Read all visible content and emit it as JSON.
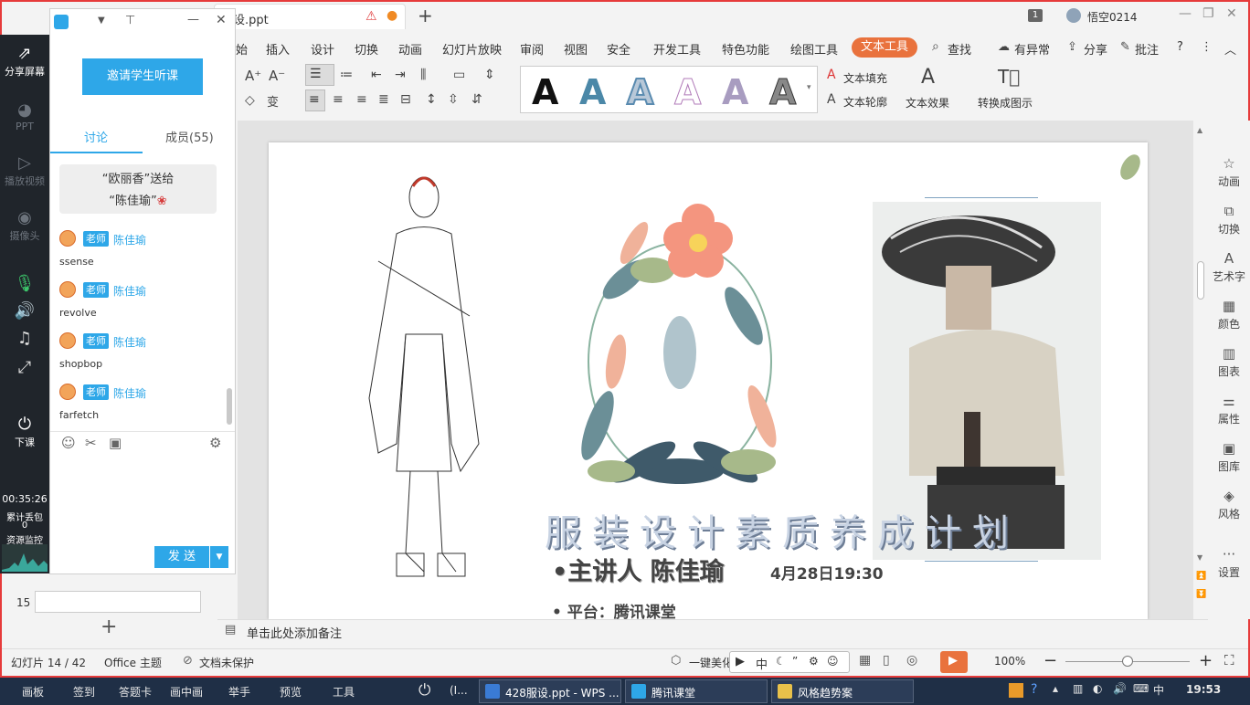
{
  "titlebar": {
    "file_tab": "设.ppt",
    "window_count": "1",
    "user": "悟空0214"
  },
  "ribbon_tabs": [
    "始",
    "插入",
    "设计",
    "切换",
    "动画",
    "幻灯片放映",
    "审阅",
    "视图",
    "安全",
    "开发工具",
    "特色功能",
    "绘图工具",
    "文本工具"
  ],
  "ribbon_right": {
    "search": "查找",
    "issue": "有异常",
    "share": "分享",
    "comment": "批注"
  },
  "ribbon": {
    "text_fill": "文本填充",
    "text_outline": "文本轮廓",
    "text_effect": "文本效果",
    "convert_to_smartart": "转换成图示"
  },
  "slide": {
    "title": "服装设计素质养成计划",
    "speaker": "•主讲人 陈佳瑜",
    "date": "4月28日19:30",
    "platform": "• 平台：腾讯课堂"
  },
  "right_sidebar": [
    "动画",
    "切换",
    "艺术字",
    "颜色",
    "图表",
    "属性",
    "图库",
    "风格",
    "设置"
  ],
  "notes_placeholder": "单击此处添加备注",
  "status": {
    "slide_info": "幻灯片 14 / 42",
    "theme": "Office 主题",
    "protect": "文档未保护",
    "beautify": "一键美化",
    "ime": "中",
    "zoom": "100%"
  },
  "thumbnail": {
    "number": "15"
  },
  "tc_left": {
    "share_screen": "分享屏幕",
    "ppt": "PPT",
    "play_video": "播放视频",
    "camera": "摄像头",
    "end_class": "下课",
    "timer": "00:35:26",
    "packet_loss_label": "累计丢包",
    "packet_loss_value": "0",
    "resource_monitor": "资源监控"
  },
  "chat": {
    "invite": "邀请学生听课",
    "tab_discussion": "讨论",
    "tab_members": "成员(55)",
    "gift_line1": "“欧丽香”送给",
    "gift_line2": "“陈佳瑜”",
    "messages": [
      {
        "role": "老师",
        "name": "陈佳瑜",
        "text": "ssense"
      },
      {
        "role": "老师",
        "name": "陈佳瑜",
        "text": "revolve"
      },
      {
        "role": "老师",
        "name": "陈佳瑜",
        "text": "shopbop"
      },
      {
        "role": "老师",
        "name": "陈佳瑜",
        "text": "farfetch"
      }
    ],
    "send": "发 送"
  },
  "taskbar": {
    "tools": [
      "画板",
      "签到",
      "答题卡",
      "画中画",
      "举手",
      "预览",
      "工具"
    ],
    "apps": [
      "428服设.ppt - WPS ...",
      "腾讯课堂",
      "风格趋势案"
    ],
    "clock": "19:53"
  },
  "colors": {
    "accent_blue": "#2ea7e8",
    "text_tools_tab": "#e9723d",
    "frame_red": "#e63b3b"
  }
}
